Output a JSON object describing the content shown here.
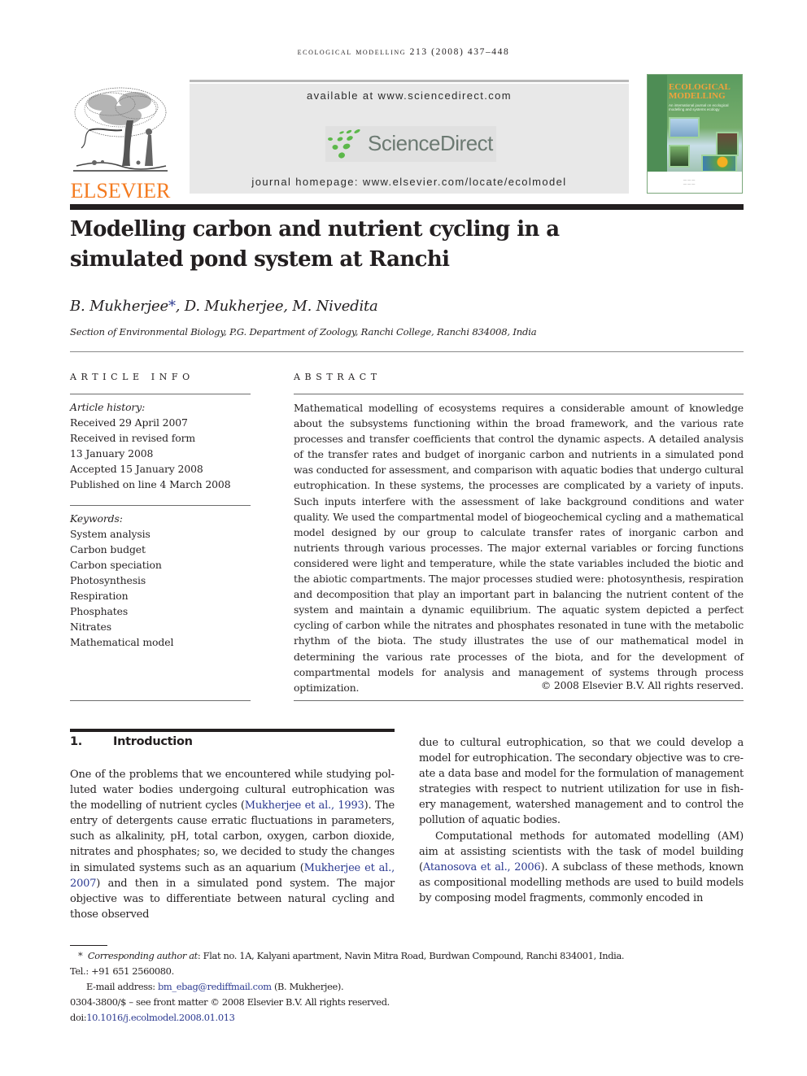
{
  "running_head": "Ecological Modelling 213 (2008) 437–448",
  "header": {
    "publisher_logo_text": "ELSEVIER",
    "available_at": "available at www.sciencedirect.com",
    "sciencedirect_logo_text": "ScienceDirect",
    "journal_homepage": "journal homepage: www.elsevier.com/locate/ecolmodel",
    "cover": {
      "title_line1": "ECOLOGICAL",
      "title_line2": "MODELLING",
      "subtitle": "An international journal on ecological modelling and systems ecology"
    },
    "colors": {
      "elsevier_orange": "#f47b20",
      "sciencedirect_green": "#5cb84a",
      "sciencedirect_gray": "#6c7a72",
      "link_blue": "#2b3990"
    }
  },
  "article": {
    "title": "Modelling carbon and nutrient cycling in a simulated pond system at Ranchi",
    "title_line1": "Modelling carbon and nutrient cycling in a",
    "title_line2": "simulated pond system at Ranchi",
    "authors": [
      {
        "name": "B. Mukherjee",
        "corresponding": true,
        "marker": "*"
      },
      {
        "name": "D. Mukherjee",
        "corresponding": false
      },
      {
        "name": "M. Nivedita",
        "corresponding": false
      }
    ],
    "author_sep": ", ",
    "affiliation": "Section of Environmental Biology, P.G. Department of Zoology, Ranchi College, Ranchi 834008, India"
  },
  "article_info": {
    "heading": "ARTICLE INFO",
    "history_label": "Article history:",
    "history": [
      "Received 29 April 2007",
      "Received in revised form",
      "13 January 2008",
      "Accepted 15 January 2008",
      "Published on line 4 March 2008"
    ],
    "keywords_label": "Keywords:",
    "keywords": [
      "System analysis",
      "Carbon budget",
      "Carbon speciation",
      "Photosynthesis",
      "Respiration",
      "Phosphates",
      "Nitrates",
      "Mathematical model"
    ]
  },
  "abstract": {
    "heading": "ABSTRACT",
    "text": "Mathematical modelling of ecosystems requires a considerable amount of knowledge about the subsystems functioning within the broad framework, and the various rate processes and transfer coefficients that control the dynamic aspects. A detailed analysis of the trans­fer rates and budget of inorganic carbon and nutrients in a simulated pond was conducted for assessment, and comparison with aquatic bodies that undergo cultural eutrophication. In these systems, the processes are complicated by a variety of inputs. Such inputs interfere with the assessment of lake background conditions and water quality. We used the compart­mental model of biogeochemical cycling and a mathematical model designed by our group to calculate transfer rates of inorganic carbon and nutrients through various processes. The major external variables or forcing functions considered were light and temperature, while the state variables included the biotic and the abiotic compartments. The major processes studied were: photosynthesis, respiration and decomposition that play an important part in balancing the nutrient content of the system and maintain a dynamic equilibrium. The aquatic system depicted a perfect cycling of carbon while the nitrates and phosphates res­onated in tune with the metabolic rhythm of the biota. The study illustrates the use of our mathematical model in determining the various rate processes of the biota, and for the development of compartmental models for analysis and management of systems through process optimization.",
    "copyright": "© 2008 Elsevier B.V. All rights reserved."
  },
  "introduction": {
    "number": "1.",
    "heading": "Introduction",
    "p1_a": "One of the problems that we encountered while studying pol­luted water bodies undergoing cultural eutrophication was the modelling of nutrient cycles (",
    "p1_cite1": "Mukherjee et al., 1993",
    "p1_b": "). The entry of detergents cause erratic fluctuations in parameters, such as alkalinity, pH, total carbon, oxygen, carbon dioxide, nitrates and phosphates; so, we decided to study the changes in sim­ulated systems such as an aquarium (",
    "p1_cite2": "Mukherjee et al., 2007",
    "p1_c": ") and then in a simulated pond system. The major objective was to differentiate between natural cycling and those observed due to cultural eutrophication, so that we could develop a model for eutrophication. The secondary objective was to cre­ate a data base and model for the formulation of management strategies with respect to nutrient utilization for use in fish­ery management, watershed management and to control the pollution of aquatic bodies.",
    "p1_left": "One of the problems that we encountered while studying pol­luted water bodies undergoing cultural eutrophication was the modelling of nutrient cycles (",
    "p1_right": "due to cultural eutrophication, so that we could develop a model for eutrophication. The secondary objective was to cre­ate a data base and model for the formulation of management strategies with respect to nutrient utilization for use in fish­ery management, watershed management and to control the pollution of aquatic bodies.",
    "p1_left_tail": ") and then in a simulated pond system. The major objective was to differentiate between natural cycling and those observed",
    "p2_a": "Computational methods for automated modelling (AM) aim at assisting scientists with the task of model building (",
    "p2_cite": "Atanosova et al., 2006",
    "p2_b": "). A subclass of these methods, known as compositional modelling methods are used to build mod­els by composing model fragments, commonly encoded in"
  },
  "footnotes": {
    "star": "*",
    "corresponding_label": "Corresponding author at",
    "corresponding_text": ": Flat no. 1A, Kalyani apartment, Navin Mitra Road, Burdwan Compound, Ranchi 834001, India.",
    "tel": "Tel.: +91 651 2560080.",
    "email_label": "E-mail address: ",
    "email": "bm_ebag@rediffmail.com",
    "email_suffix": " (B. Mukherjee).",
    "front_matter": "0304-3800/$ – see front matter © 2008 Elsevier B.V. All rights reserved.",
    "doi_label": "doi:",
    "doi": "10.1016/j.ecolmodel.2008.01.013"
  }
}
